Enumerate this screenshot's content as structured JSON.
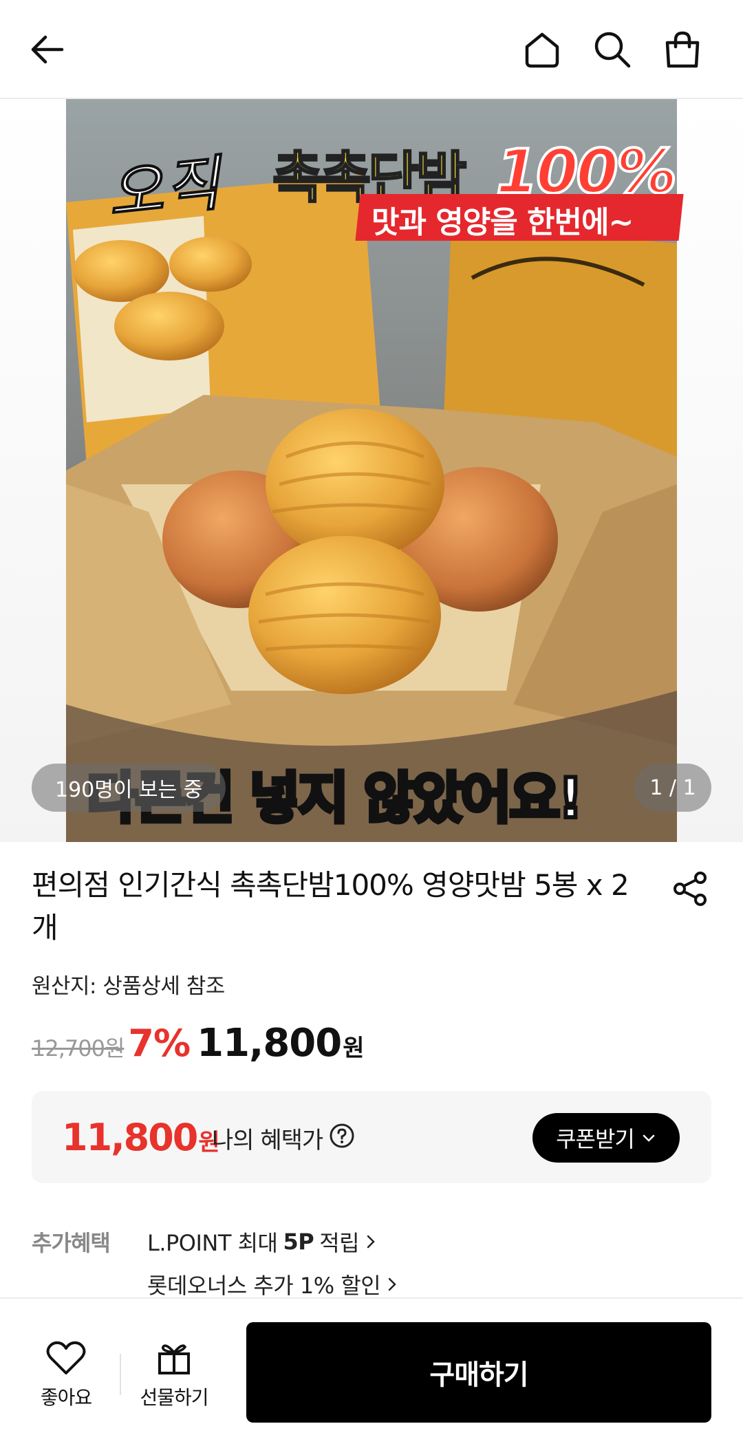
{
  "header": {
    "back_icon": "arrow-left-icon",
    "home_icon": "home-icon",
    "search_icon": "search-icon",
    "cart_icon": "shopping-bag-icon"
  },
  "gallery": {
    "headline_prefix": "오직",
    "headline_main": "촉촉단밤",
    "headline_percent": "100%",
    "ribbon_text": "맛과 영양을 한번에~",
    "bottom_caption": "다른건 넣지 않았어요!",
    "viewers": "190명이 보는 중",
    "counter": "1 / 1"
  },
  "product": {
    "title": "편의점 인기간식 촉촉단밤100% 영양맛밤 5봉 x 2개",
    "origin": "원산지: 상품상세 참조",
    "original_price": "12,700원",
    "discount": "7%",
    "sale_price": "11,800",
    "sale_unit": "원"
  },
  "benefit": {
    "price": "11,800",
    "unit": "원",
    "label": "나의 혜택가",
    "coupon_button": "쿠폰받기"
  },
  "extra_benefits": {
    "label": "추가혜택",
    "item1_prefix": "L.POINT 최대",
    "item1_bold": "5P",
    "item1_suffix": "적립",
    "item2": "롯데오너스 추가 1% 할인"
  },
  "bottom_bar": {
    "like_label": "좋아요",
    "gift_label": "선물하기",
    "buy_label": "구매하기"
  },
  "colors": {
    "accent_red": "#e8322c",
    "black": "#000000"
  }
}
